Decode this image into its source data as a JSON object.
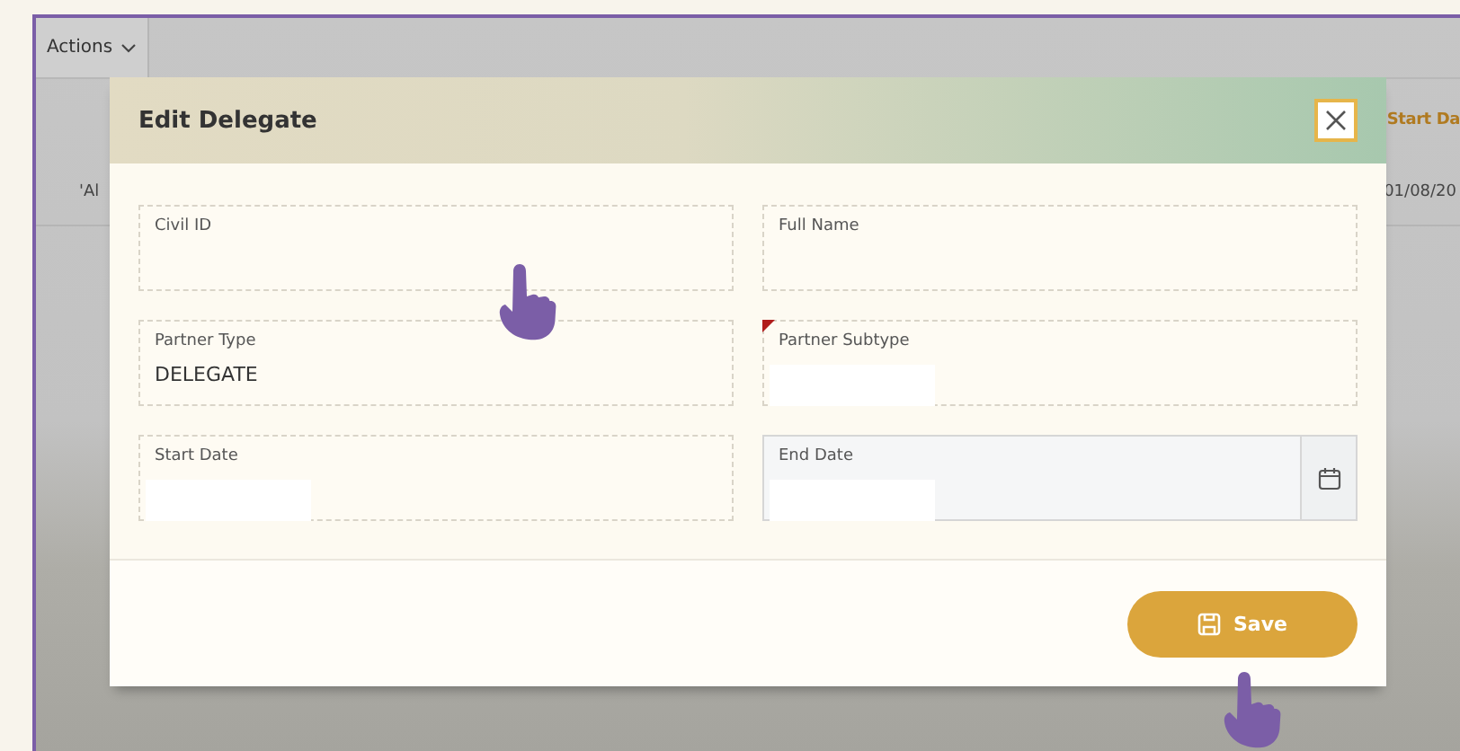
{
  "app": {
    "actions_menu": {
      "label": "Actions"
    },
    "column_header": "Start Da",
    "row": {
      "cell_1": "'Al",
      "cell_2": "01/08/20"
    }
  },
  "dialog": {
    "title": "Edit Delegate",
    "fields": [
      {
        "label": "Civil ID",
        "kind": "text",
        "required": false,
        "redacted": false
      },
      {
        "label": "Full Name",
        "kind": "text",
        "required": false,
        "redacted": false
      },
      {
        "label": "Partner Type",
        "kind": "text",
        "value": "DELEGATE",
        "required": false,
        "redacted": false
      },
      {
        "label": "Partner Subtype",
        "kind": "text",
        "required": true,
        "redacted": true
      },
      {
        "label": "Start Date",
        "kind": "text",
        "required": false,
        "redacted": true
      },
      {
        "label": "End Date",
        "kind": "date",
        "required": false,
        "redacted": true
      }
    ],
    "save_button": {
      "label": "Save"
    }
  }
}
